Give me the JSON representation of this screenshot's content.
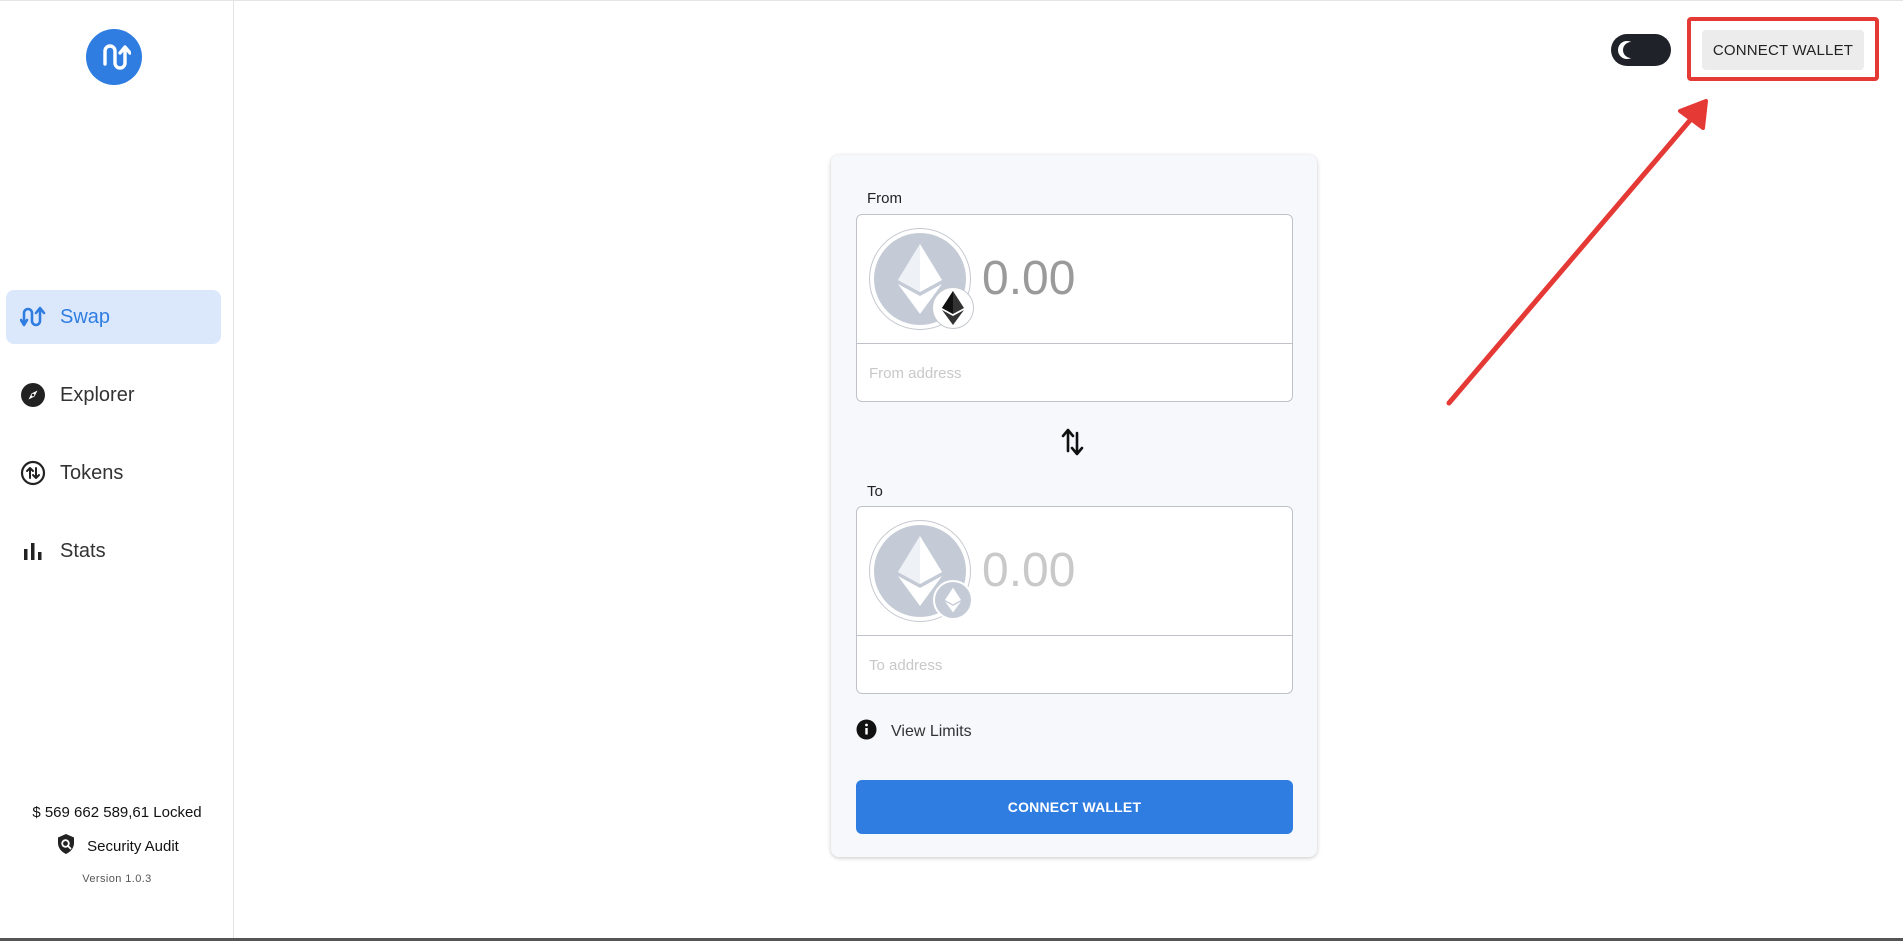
{
  "sidebar": {
    "items": [
      {
        "label": "Swap",
        "icon": "swap-icon",
        "active": true
      },
      {
        "label": "Explorer",
        "icon": "compass-icon"
      },
      {
        "label": "Tokens",
        "icon": "token-exchange-icon"
      },
      {
        "label": "Stats",
        "icon": "bar-chart-icon"
      }
    ],
    "locked": "$ 569 662 589,61 Locked",
    "audit_label": "Security Audit",
    "version": "Version 1.0.3"
  },
  "header": {
    "connect_label": "CONNECT WALLET",
    "theme_toggle_icon": "moon-icon"
  },
  "swap": {
    "from_label": "From",
    "from_amount": "0.00",
    "from_address_placeholder": "From address",
    "from_token_icon": "ethereum-icon",
    "to_label": "To",
    "to_amount": "0.00",
    "to_address_placeholder": "To address",
    "to_token_icon": "ethereum-icon",
    "switch_icon": "swap-direction-icon",
    "limits_label": "View Limits",
    "connect_label": "CONNECT WALLET"
  },
  "colors": {
    "accent": "#2f7de1",
    "active_nav_bg": "#dbe8fc",
    "annotation": "#e53935",
    "card_bg": "#f6f8fc"
  }
}
